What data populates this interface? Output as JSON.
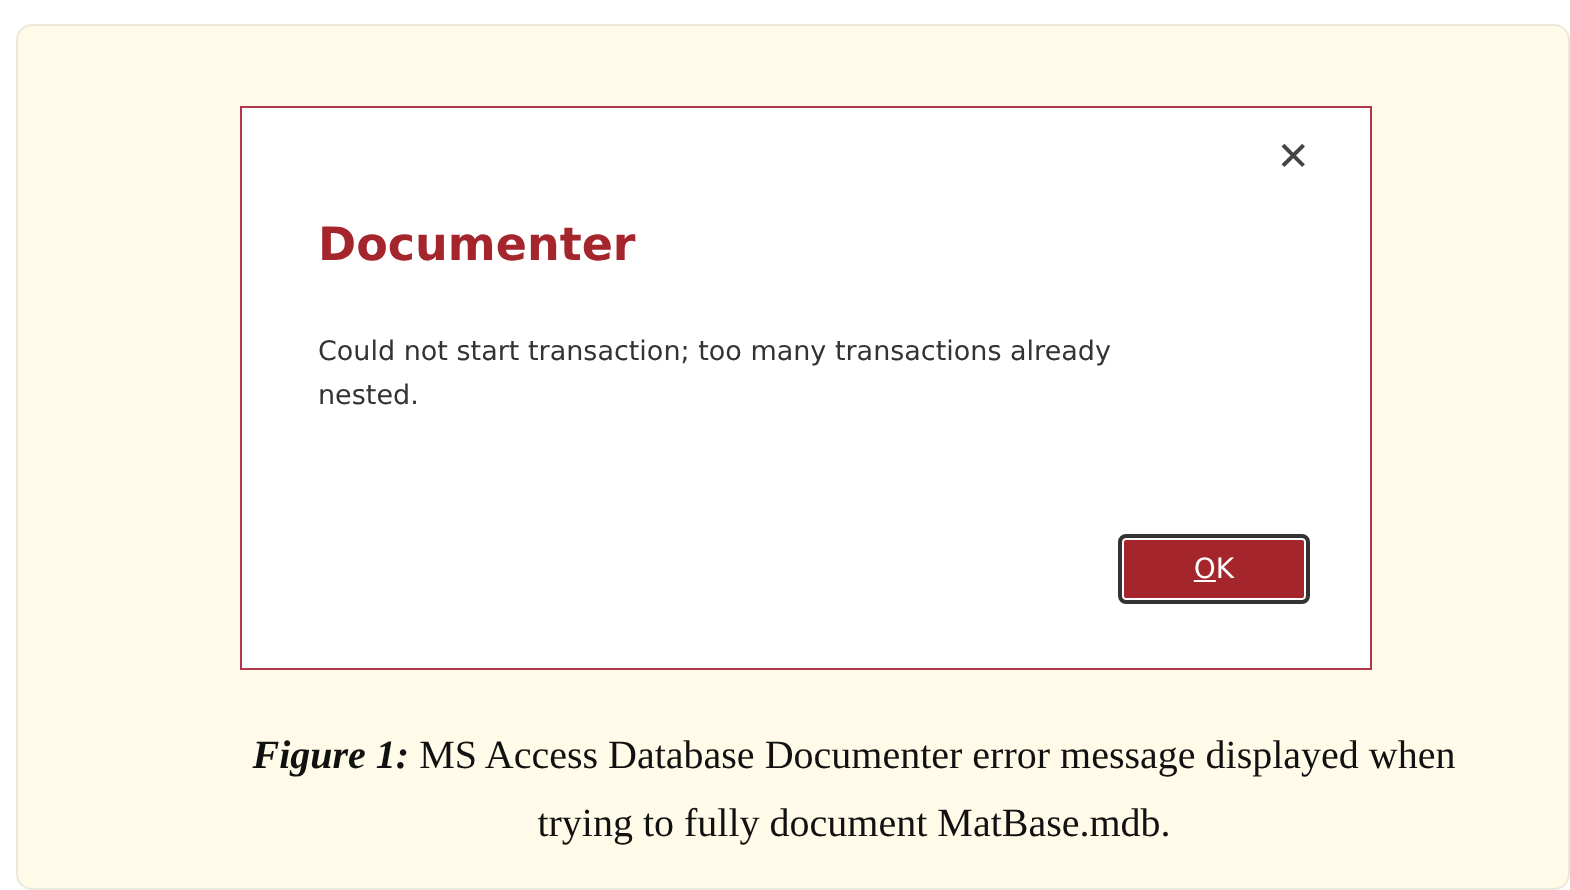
{
  "figure": {
    "dialog": {
      "title": "Documenter",
      "message": "Could not start transaction; too many transactions already nested.",
      "close_symbol": "✕",
      "button": {
        "mnemonic": "O",
        "rest": "K"
      }
    },
    "caption": {
      "label": "Figure 1:",
      "text": "MS Access Database Documenter error message displayed when trying to fully document MatBase.mdb."
    }
  }
}
